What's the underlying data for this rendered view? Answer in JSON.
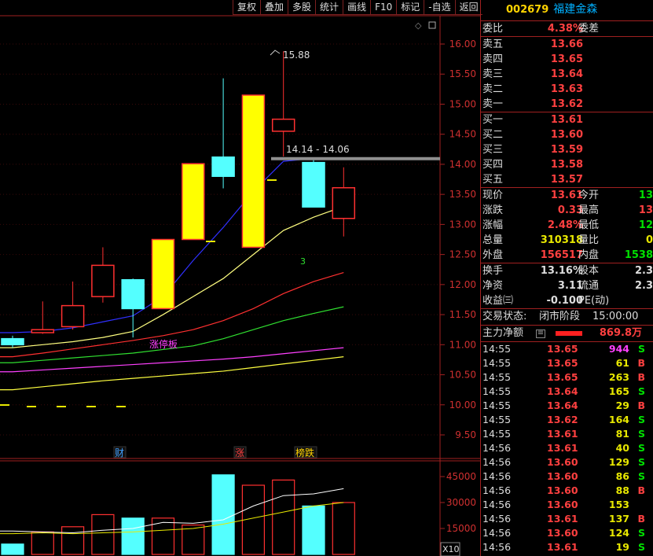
{
  "toolbar": [
    "复权",
    "叠加",
    "多股",
    "统计",
    "画线",
    "F10",
    "标记",
    "-自选",
    "返回"
  ],
  "chart": {
    "price_axis": [
      "16.00",
      "15.50",
      "15.00",
      "14.50",
      "14.00",
      "13.50",
      "13.00",
      "12.50",
      "12.00",
      "11.50",
      "11.00",
      "10.50",
      "10.00",
      "9.50"
    ],
    "volume_axis": [
      "45000",
      "30000",
      "15000"
    ],
    "volume_unit": "X10",
    "high_label": "15.88",
    "range_label": "14.14 - 14.06",
    "limit_up_label": "涨停板",
    "marker_3": "3",
    "event_markers": [
      {
        "text": "财",
        "color": "#40a0ff"
      },
      {
        "text": "涨",
        "color": "#ff4040"
      },
      {
        "text": "榜跌",
        "color": "#ffd400"
      }
    ],
    "colors": {
      "up": "#ff3030",
      "down": "#54ffff",
      "limit": "#ffff00",
      "ma5": "#ffff80",
      "ma10": "#3030ff",
      "ma20": "#ff3030",
      "ma30": "#30e030",
      "ma60": "#ff40ff",
      "ma120": "#ffff40"
    }
  },
  "chart_data": {
    "type": "candlestick",
    "candles": [
      {
        "o": 11.1,
        "c": 11.0,
        "h": 11.15,
        "l": 10.95,
        "dir": "down"
      },
      {
        "o": 11.2,
        "c": 11.25,
        "h": 11.72,
        "l": 11.18,
        "dir": "up"
      },
      {
        "o": 11.3,
        "c": 11.65,
        "h": 12.05,
        "l": 11.25,
        "dir": "up"
      },
      {
        "o": 11.8,
        "c": 12.32,
        "h": 12.62,
        "l": 11.7,
        "dir": "up"
      },
      {
        "o": 12.08,
        "c": 11.6,
        "h": 12.1,
        "l": 11.12,
        "dir": "down"
      },
      {
        "o": 11.6,
        "c": 12.75,
        "h": 12.75,
        "l": 11.6,
        "dir": "limit"
      },
      {
        "o": 12.75,
        "c": 14.01,
        "h": 14.01,
        "l": 12.75,
        "dir": "limit"
      },
      {
        "o": 14.12,
        "c": 13.8,
        "h": 15.43,
        "l": 13.6,
        "dir": "down"
      },
      {
        "o": 12.62,
        "c": 15.15,
        "h": 15.15,
        "l": 12.62,
        "dir": "limit"
      },
      {
        "o": 14.55,
        "c": 14.75,
        "h": 15.88,
        "l": 14.13,
        "dir": "up"
      },
      {
        "o": 14.03,
        "c": 13.29,
        "h": 14.07,
        "l": 13.29,
        "dir": "down"
      },
      {
        "o": 13.1,
        "c": 13.61,
        "h": 13.95,
        "l": 12.8,
        "dir": "up"
      }
    ],
    "ma": {
      "ma5": [
        10.95,
        11.0,
        11.05,
        11.12,
        11.22,
        11.5,
        11.8,
        12.1,
        12.5,
        12.9,
        13.12,
        13.3
      ],
      "ma10": [
        11.2,
        11.22,
        11.28,
        11.38,
        11.48,
        11.8,
        12.4,
        12.95,
        13.55,
        14.05,
        14.1,
        14.1
      ],
      "ma20": [
        10.8,
        10.86,
        10.93,
        11.0,
        11.07,
        11.15,
        11.25,
        11.4,
        11.6,
        11.85,
        12.05,
        12.2
      ],
      "ma30": [
        10.7,
        10.74,
        10.78,
        10.82,
        10.86,
        10.92,
        10.98,
        11.1,
        11.25,
        11.4,
        11.52,
        11.63
      ],
      "ma60": [
        10.55,
        10.58,
        10.61,
        10.64,
        10.67,
        10.7,
        10.73,
        10.76,
        10.8,
        10.85,
        10.9,
        10.95
      ],
      "ma120": [
        10.25,
        10.3,
        10.35,
        10.4,
        10.44,
        10.48,
        10.52,
        10.56,
        10.62,
        10.68,
        10.74,
        10.8
      ]
    },
    "volume": [
      6000,
      13000,
      16000,
      23000,
      21000,
      21000,
      17000,
      46000,
      40000,
      43000,
      28000,
      30000
    ],
    "vol_ma": [
      13500,
      13000,
      12500,
      14000,
      15000,
      18500,
      18000,
      20000,
      28000,
      34000,
      35000,
      38000
    ],
    "vol_ma2": [
      12000,
      12500,
      12000,
      12500,
      13000,
      14000,
      15000,
      17500,
      21000,
      24500,
      28000,
      30000
    ]
  },
  "panel": {
    "code": "002679",
    "name": "福建金森",
    "weibi_label": "委比",
    "weibi_value": "4.38%",
    "weicha_label": "委差",
    "sells": [
      {
        "label": "卖五",
        "price": "13.66"
      },
      {
        "label": "卖四",
        "price": "13.65"
      },
      {
        "label": "卖三",
        "price": "13.64"
      },
      {
        "label": "卖二",
        "price": "13.63"
      },
      {
        "label": "卖一",
        "price": "13.62"
      }
    ],
    "buys": [
      {
        "label": "买一",
        "price": "13.61"
      },
      {
        "label": "买二",
        "price": "13.60"
      },
      {
        "label": "买三",
        "price": "13.59"
      },
      {
        "label": "买四",
        "price": "13.58"
      },
      {
        "label": "买五",
        "price": "13.57"
      }
    ],
    "quote": [
      {
        "l1": "现价",
        "v1": "13.61",
        "c1": "red",
        "l2": "今开",
        "v2": "13",
        "c2": "green"
      },
      {
        "l1": "涨跌",
        "v1": "0.33",
        "c1": "red",
        "l2": "最高",
        "v2": "13",
        "c2": "red"
      },
      {
        "l1": "涨幅",
        "v1": "2.48%",
        "c1": "red",
        "l2": "最低",
        "v2": "12",
        "c2": "green"
      },
      {
        "l1": "总量",
        "v1": "310318",
        "c1": "yellow",
        "l2": "量比",
        "v2": "0",
        "c2": "yellow"
      },
      {
        "l1": "外盘",
        "v1": "156517",
        "c1": "red",
        "l2": "内盘",
        "v2": "1538",
        "c2": "green"
      }
    ],
    "stats": [
      {
        "l1": "换手",
        "v1": "13.16%",
        "c1": "white",
        "l2": "股本",
        "v2": "2.3",
        "c2": "white"
      },
      {
        "l1": "净资",
        "v1": "3.11",
        "c1": "white",
        "l2": "流通",
        "v2": "2.3",
        "c2": "white"
      },
      {
        "l1": "收益㈢",
        "v1": "-0.100",
        "c1": "white",
        "l2": "PE(动)",
        "v2": "",
        "c2": "white"
      }
    ],
    "trade_status_label": "交易状态:",
    "trade_status": "闭市阶段",
    "trade_time": "15:00:00",
    "main_net_label": "主力净额",
    "main_net_value": "869.8万",
    "ticks": [
      {
        "time": "14:55",
        "price": "13.65",
        "vol": "944",
        "dir": "S",
        "pc": "red",
        "vc": "magenta",
        "dc": "green"
      },
      {
        "time": "14:55",
        "price": "13.65",
        "vol": "61",
        "dir": "B",
        "pc": "red",
        "vc": "yellow",
        "dc": "red"
      },
      {
        "time": "14:55",
        "price": "13.65",
        "vol": "263",
        "dir": "B",
        "pc": "red",
        "vc": "yellow",
        "dc": "red"
      },
      {
        "time": "14:55",
        "price": "13.64",
        "vol": "165",
        "dir": "S",
        "pc": "red",
        "vc": "yellow",
        "dc": "green"
      },
      {
        "time": "14:55",
        "price": "13.64",
        "vol": "29",
        "dir": "B",
        "pc": "red",
        "vc": "yellow",
        "dc": "red"
      },
      {
        "time": "14:55",
        "price": "13.62",
        "vol": "164",
        "dir": "S",
        "pc": "red",
        "vc": "yellow",
        "dc": "green"
      },
      {
        "time": "14:55",
        "price": "13.61",
        "vol": "81",
        "dir": "S",
        "pc": "red",
        "vc": "yellow",
        "dc": "green"
      },
      {
        "time": "14:56",
        "price": "13.61",
        "vol": "40",
        "dir": "S",
        "pc": "red",
        "vc": "yellow",
        "dc": "green"
      },
      {
        "time": "14:56",
        "price": "13.60",
        "vol": "129",
        "dir": "S",
        "pc": "red",
        "vc": "yellow",
        "dc": "green"
      },
      {
        "time": "14:56",
        "price": "13.60",
        "vol": "86",
        "dir": "S",
        "pc": "red",
        "vc": "yellow",
        "dc": "green"
      },
      {
        "time": "14:56",
        "price": "13.60",
        "vol": "88",
        "dir": "B",
        "pc": "red",
        "vc": "yellow",
        "dc": "red"
      },
      {
        "time": "14:56",
        "price": "13.60",
        "vol": "153",
        "dir": "",
        "pc": "red",
        "vc": "yellow",
        "dc": "white"
      },
      {
        "time": "14:56",
        "price": "13.61",
        "vol": "137",
        "dir": "B",
        "pc": "red",
        "vc": "yellow",
        "dc": "red"
      },
      {
        "time": "14:56",
        "price": "13.60",
        "vol": "124",
        "dir": "S",
        "pc": "red",
        "vc": "yellow",
        "dc": "green"
      },
      {
        "time": "14:56",
        "price": "13.61",
        "vol": "19",
        "dir": "S",
        "pc": "red",
        "vc": "yellow",
        "dc": "green"
      }
    ]
  }
}
